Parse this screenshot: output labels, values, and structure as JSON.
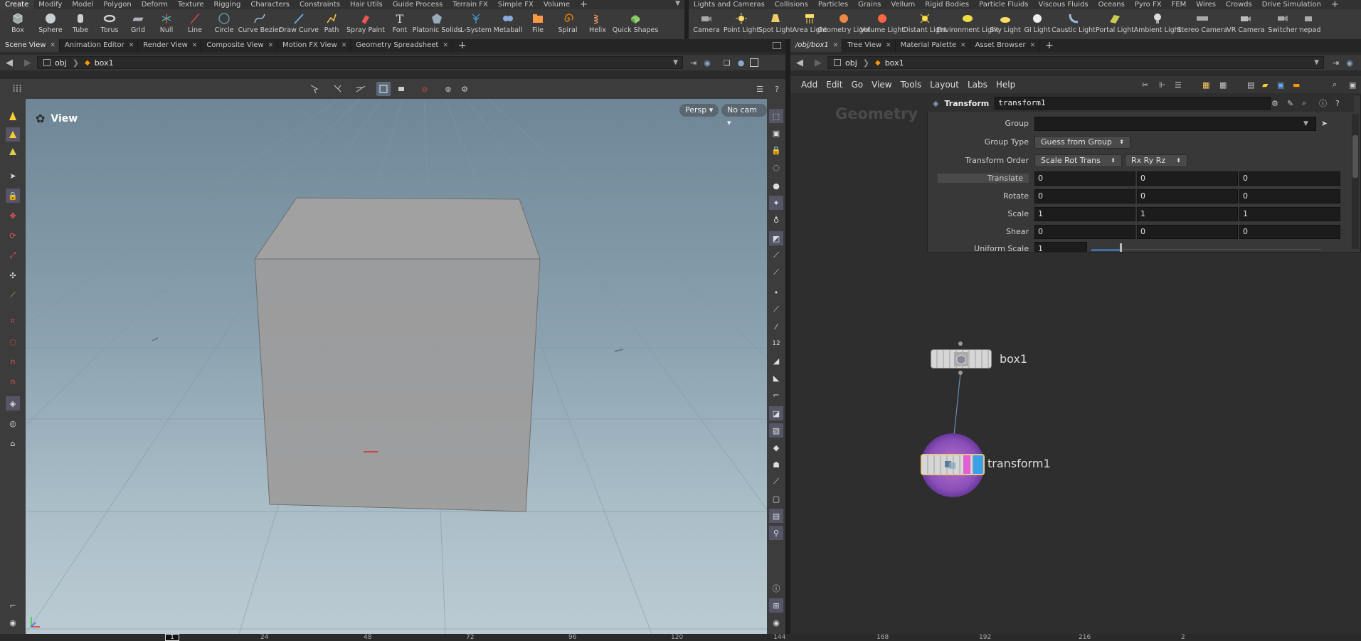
{
  "left_shelf": {
    "tabs": [
      "Create",
      "Modify",
      "Model",
      "Polygon",
      "Deform",
      "Texture",
      "Rigging",
      "Characters",
      "Constraints",
      "Hair Utils",
      "Guide Process",
      "Terrain FX",
      "Simple FX",
      "Volume",
      "+"
    ],
    "tools": [
      "Box",
      "Sphere",
      "Tube",
      "Torus",
      "Grid",
      "Null",
      "Line",
      "Circle",
      "Curve Bezier",
      "Draw Curve",
      "Path",
      "Spray Paint",
      "Font",
      "Platonic Solids",
      "L-System",
      "Metaball",
      "File",
      "Spiral",
      "Helix",
      "Quick Shapes"
    ]
  },
  "right_shelf": {
    "tabs": [
      "Lights and Cameras",
      "Collisions",
      "Particles",
      "Grains",
      "Vellum",
      "Rigid Bodies",
      "Particle Fluids",
      "Viscous Fluids",
      "Oceans",
      "Pyro FX",
      "FEM",
      "Wires",
      "Crowds",
      "Drive Simulation",
      "+"
    ],
    "tools": [
      "Camera",
      "Point Light",
      "Spot Light",
      "Area Light",
      "Geometry Light",
      "Volume Light",
      "Distant Light",
      "Environment Light",
      "Sky Light",
      "GI Light",
      "Caustic Light",
      "Portal Light",
      "Ambient Light",
      "Stereo Camera",
      "VR Camera",
      "Switcher",
      "Gamepad Ca"
    ]
  },
  "left_pane": {
    "tabs": [
      "Scene View",
      "Animation Editor",
      "Render View",
      "Composite View",
      "Motion FX View",
      "Geometry Spreadsheet"
    ],
    "path": [
      "obj",
      "box1"
    ],
    "viewport_label": "View",
    "persp_btn": "Persp",
    "cam_btn": "No cam"
  },
  "right_pane": {
    "tabs": [
      "/obj/box1",
      "Tree View",
      "Material Palette",
      "Asset Browser"
    ],
    "path": [
      "obj",
      "box1"
    ],
    "menu": [
      "Add",
      "Edit",
      "Go",
      "View",
      "Tools",
      "Layout",
      "Labs",
      "Help"
    ],
    "network_label": "Geometry"
  },
  "parms": {
    "node_type": "Transform",
    "node_name": "transform1",
    "group_label": "Group",
    "group_value": "",
    "group_type_label": "Group Type",
    "group_type_value": "Guess from Group",
    "xform_order_label": "Transform Order",
    "xform_order_value": "Scale Rot Trans",
    "rot_order_value": "Rx Ry Rz",
    "translate_label": "Translate",
    "translate": [
      "0",
      "0",
      "0"
    ],
    "rotate_label": "Rotate",
    "rotate": [
      "0",
      "0",
      "0"
    ],
    "scale_label": "Scale",
    "scale": [
      "1",
      "1",
      "1"
    ],
    "shear_label": "Shear",
    "shear": [
      "0",
      "0",
      "0"
    ],
    "uniform_scale_label": "Uniform Scale",
    "uniform_scale": "1"
  },
  "nodes": {
    "box_name": "box1",
    "transform_name": "transform1"
  },
  "timeline": {
    "frame": "1",
    "ticks": [
      "24",
      "48",
      "72",
      "96",
      "120",
      "144",
      "168",
      "192",
      "216",
      "2"
    ]
  },
  "colors": {
    "accent_blue": "#3aa0e8",
    "node_pink": "#e060d0",
    "viewport_top": "#6e8696",
    "viewport_bottom": "#bccbd3"
  }
}
